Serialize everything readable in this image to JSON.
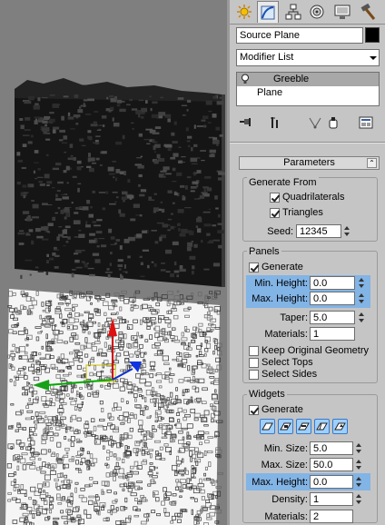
{
  "tabs": [
    {
      "name": "create-tab",
      "icon": "sun-create-icon",
      "active": false
    },
    {
      "name": "modify-tab",
      "icon": "modify-curve-icon",
      "active": true
    },
    {
      "name": "hierarchy-tab",
      "icon": "hierarchy-icon",
      "active": false
    },
    {
      "name": "motion-tab",
      "icon": "motion-icon",
      "active": false
    },
    {
      "name": "display-tab",
      "icon": "display-monitor-icon",
      "active": false
    },
    {
      "name": "utilities-tab",
      "icon": "hammer-icon",
      "active": false
    }
  ],
  "object": {
    "name": "Source Plane",
    "color": "#000000"
  },
  "modifier_list": {
    "label": "Modifier List"
  },
  "stack": {
    "items": [
      "Greeble",
      "Plane"
    ]
  },
  "stack_tools": [
    "pin-stack-icon",
    "show-end-result-icon",
    "make-unique-icon",
    "remove-modifier-icon",
    "configure-sets-icon"
  ],
  "params": {
    "title": "Parameters",
    "collapse": "⌃",
    "generate_from": {
      "title": "Generate From",
      "quadrilaterals": "Quadrilaterals",
      "triangles": "Triangles",
      "seed_label": "Seed:",
      "seed": "12345"
    },
    "panels": {
      "title": "Panels",
      "generate": "Generate",
      "min_height_label": "Min. Height:",
      "min_height": "0.0",
      "max_height_label": "Max. Height:",
      "max_height": "0.0",
      "taper_label": "Taper:",
      "taper": "5.0",
      "materials_label": "Materials:",
      "materials": "1",
      "keep_original": "Keep Original Geometry",
      "select_tops": "Select Tops",
      "select_sides": "Select Sides"
    },
    "widgets": {
      "title": "Widgets",
      "generate": "Generate",
      "min_size_label": "Min. Size:",
      "min_size": "5.0",
      "max_size_label": "Max. Size:",
      "max_size": "50.0",
      "max_height_label": "Max. Height:",
      "max_height": "0.0",
      "density_label": "Density:",
      "density": "1",
      "materials_label": "Materials:",
      "materials": "2"
    }
  },
  "colors": {
    "highlight": "#82b4e6",
    "panel": "#c5c5c5",
    "viewport": "#7f7f7f"
  }
}
